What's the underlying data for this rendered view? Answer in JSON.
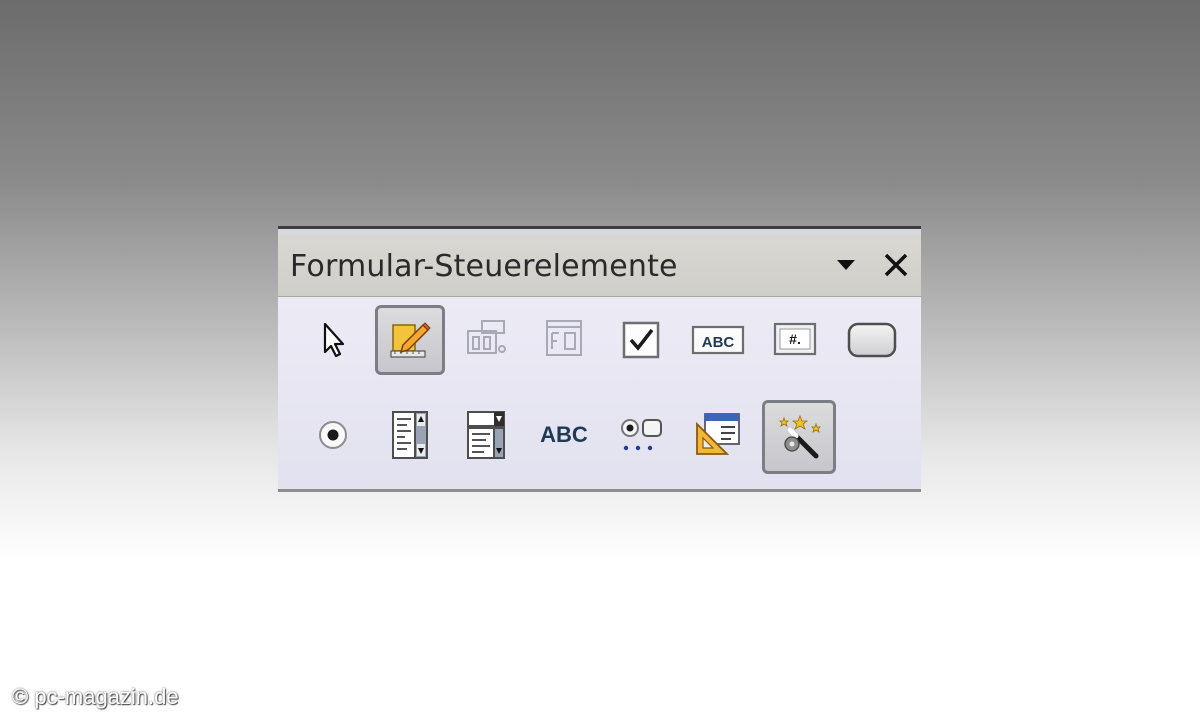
{
  "toolbar": {
    "title": "Formular-Steuerelemente",
    "row1": [
      {
        "icon": "select-pointer-icon",
        "state": "normal"
      },
      {
        "icon": "design-mode-icon",
        "state": "pressed"
      },
      {
        "icon": "control-properties-icon",
        "state": "disabled"
      },
      {
        "icon": "form-properties-icon",
        "state": "disabled"
      },
      {
        "icon": "checkbox-icon",
        "state": "normal"
      },
      {
        "icon": "text-box-icon",
        "state": "normal"
      },
      {
        "icon": "formatted-field-icon",
        "state": "normal"
      },
      {
        "icon": "push-button-icon",
        "state": "normal"
      }
    ],
    "row2": [
      {
        "icon": "option-button-icon",
        "state": "normal"
      },
      {
        "icon": "list-box-icon",
        "state": "normal"
      },
      {
        "icon": "combo-box-icon",
        "state": "normal"
      },
      {
        "icon": "label-field-icon",
        "state": "normal"
      },
      {
        "icon": "more-controls-icon",
        "state": "normal"
      },
      {
        "icon": "form-design-icon",
        "state": "normal"
      },
      {
        "icon": "wizards-on-off-icon",
        "state": "pressed"
      }
    ],
    "text_box_label": "ABC",
    "label_field_label": "ABC",
    "formatted_field_label": "#."
  },
  "watermark": "© pc-magazin.de"
}
